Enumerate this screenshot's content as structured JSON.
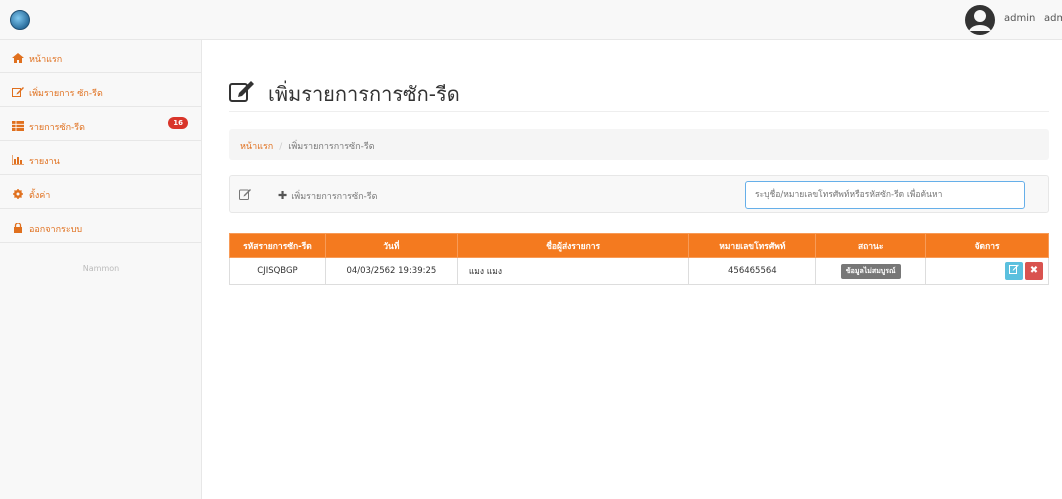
{
  "header": {
    "user_name": "admin",
    "user_name_2": "adm"
  },
  "sidebar": {
    "items": [
      {
        "label": "หน้าแรก",
        "icon": "home-icon"
      },
      {
        "label": "เพิ่มรายการ ซัก-รีด",
        "icon": "edit-icon"
      },
      {
        "label": "รายการซัก-รีด",
        "icon": "table-icon",
        "badge": "16"
      },
      {
        "label": "รายงาน",
        "icon": "bar-chart-icon"
      },
      {
        "label": "ตั้งค่า",
        "icon": "gear-icon"
      },
      {
        "label": "ออกจากระบบ",
        "icon": "lock-icon"
      }
    ],
    "footer": "Nammon"
  },
  "page": {
    "title": "เพิ่มรายการการซัก-รีด"
  },
  "breadcrumb": {
    "home": "หน้าแรก",
    "separator": "/",
    "current": "เพิ่มรายการการซัก-รีด"
  },
  "toolbar": {
    "add_label": "เพิ่มรายการการซัก-รีด",
    "search_placeholder": "ระบุชื่อ/หมายเลขโทรศัพท์หรือรหัสซัก-รีด เพื่อค้นหา"
  },
  "table": {
    "headers": [
      "รหัสรายการซัก-รีด",
      "วันที่",
      "ชื่อผู้ส่งรายการ",
      "หมายเลขโทรศัพท์",
      "สถานะ",
      "จัดการ"
    ],
    "rows": [
      {
        "code": "CJISQBGP",
        "date": "04/03/2562 19:39:25",
        "sender": "แมง  แมง",
        "phone": "456465564",
        "status": "ข้อมูลไม่สมบูรณ์"
      }
    ]
  },
  "colors": {
    "accent": "#f47a1f",
    "badge": "#d9352a",
    "edit_button": "#5bc0de",
    "delete_button": "#d9534f"
  }
}
